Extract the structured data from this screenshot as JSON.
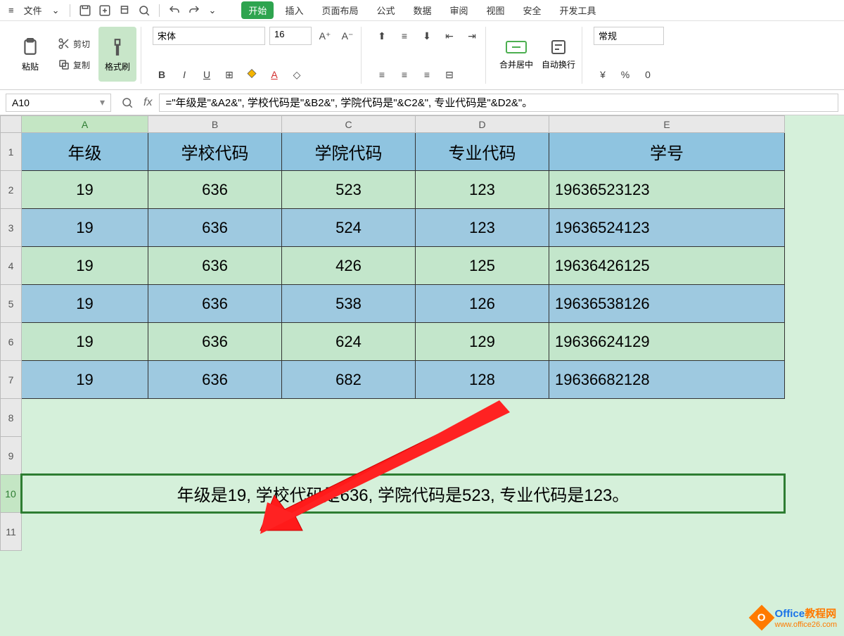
{
  "menubar": {
    "file": "文件",
    "tabs": [
      "开始",
      "插入",
      "页面布局",
      "公式",
      "数据",
      "审阅",
      "视图",
      "安全",
      "开发工具"
    ],
    "active_tab": "开始"
  },
  "ribbon": {
    "paste": "粘贴",
    "cut": "剪切",
    "copy": "复制",
    "format_painter": "格式刷",
    "font_name": "宋体",
    "font_size": "16",
    "merge_center": "合并居中",
    "auto_wrap": "自动换行",
    "number_format": "常规"
  },
  "namebox": "A10",
  "formula": "=\"年级是\"&A2&\", 学校代码是\"&B2&\", 学院代码是\"&C2&\", 专业代码是\"&D2&\"。",
  "columns": [
    "A",
    "B",
    "C",
    "D",
    "E"
  ],
  "headers": [
    "年级",
    "学校代码",
    "学院代码",
    "专业代码",
    "学号"
  ],
  "rows": [
    {
      "a": "19",
      "b": "636",
      "c": "523",
      "d": "123",
      "e": "19636523123"
    },
    {
      "a": "19",
      "b": "636",
      "c": "524",
      "d": "123",
      "e": "19636524123"
    },
    {
      "a": "19",
      "b": "636",
      "c": "426",
      "d": "125",
      "e": "19636426125"
    },
    {
      "a": "19",
      "b": "636",
      "c": "538",
      "d": "126",
      "e": "19636538126"
    },
    {
      "a": "19",
      "b": "636",
      "c": "624",
      "d": "129",
      "e": "19636624129"
    },
    {
      "a": "19",
      "b": "636",
      "c": "682",
      "d": "128",
      "e": "19636682128"
    }
  ],
  "result_text": "年级是19, 学校代码是636, 学院代码是523, 专业代码是123。",
  "watermark": {
    "brand1": "Office",
    "brand2": "教程网",
    "url": "www.office26.com"
  }
}
